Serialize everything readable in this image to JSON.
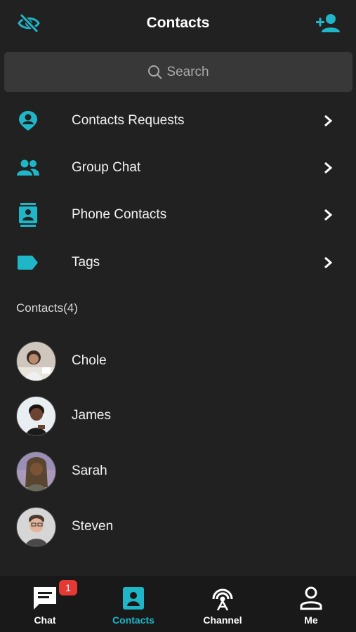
{
  "colors": {
    "accent": "#1fb6c8",
    "background": "#212121",
    "badge": "#e53935"
  },
  "header": {
    "title": "Contacts",
    "left_icon": "eye-slash-icon",
    "right_icon": "add-contact-icon"
  },
  "search": {
    "placeholder": "Search",
    "icon": "search-icon"
  },
  "menu": [
    {
      "label": "Contacts Requests",
      "icon": "contact-request-icon"
    },
    {
      "label": "Group Chat",
      "icon": "group-icon"
    },
    {
      "label": "Phone Contacts",
      "icon": "phone-contacts-icon"
    },
    {
      "label": "Tags",
      "icon": "tag-icon"
    }
  ],
  "contacts_section": {
    "label": "Contacts(4)"
  },
  "contacts": [
    {
      "name": "Chole"
    },
    {
      "name": "James"
    },
    {
      "name": "Sarah"
    },
    {
      "name": "Steven"
    }
  ],
  "tabs": [
    {
      "label": "Chat",
      "icon": "chat-icon",
      "badge": "1"
    },
    {
      "label": "Contacts",
      "icon": "contacts-icon",
      "active": true
    },
    {
      "label": "Channel",
      "icon": "broadcast-icon"
    },
    {
      "label": "Me",
      "icon": "person-icon"
    }
  ]
}
